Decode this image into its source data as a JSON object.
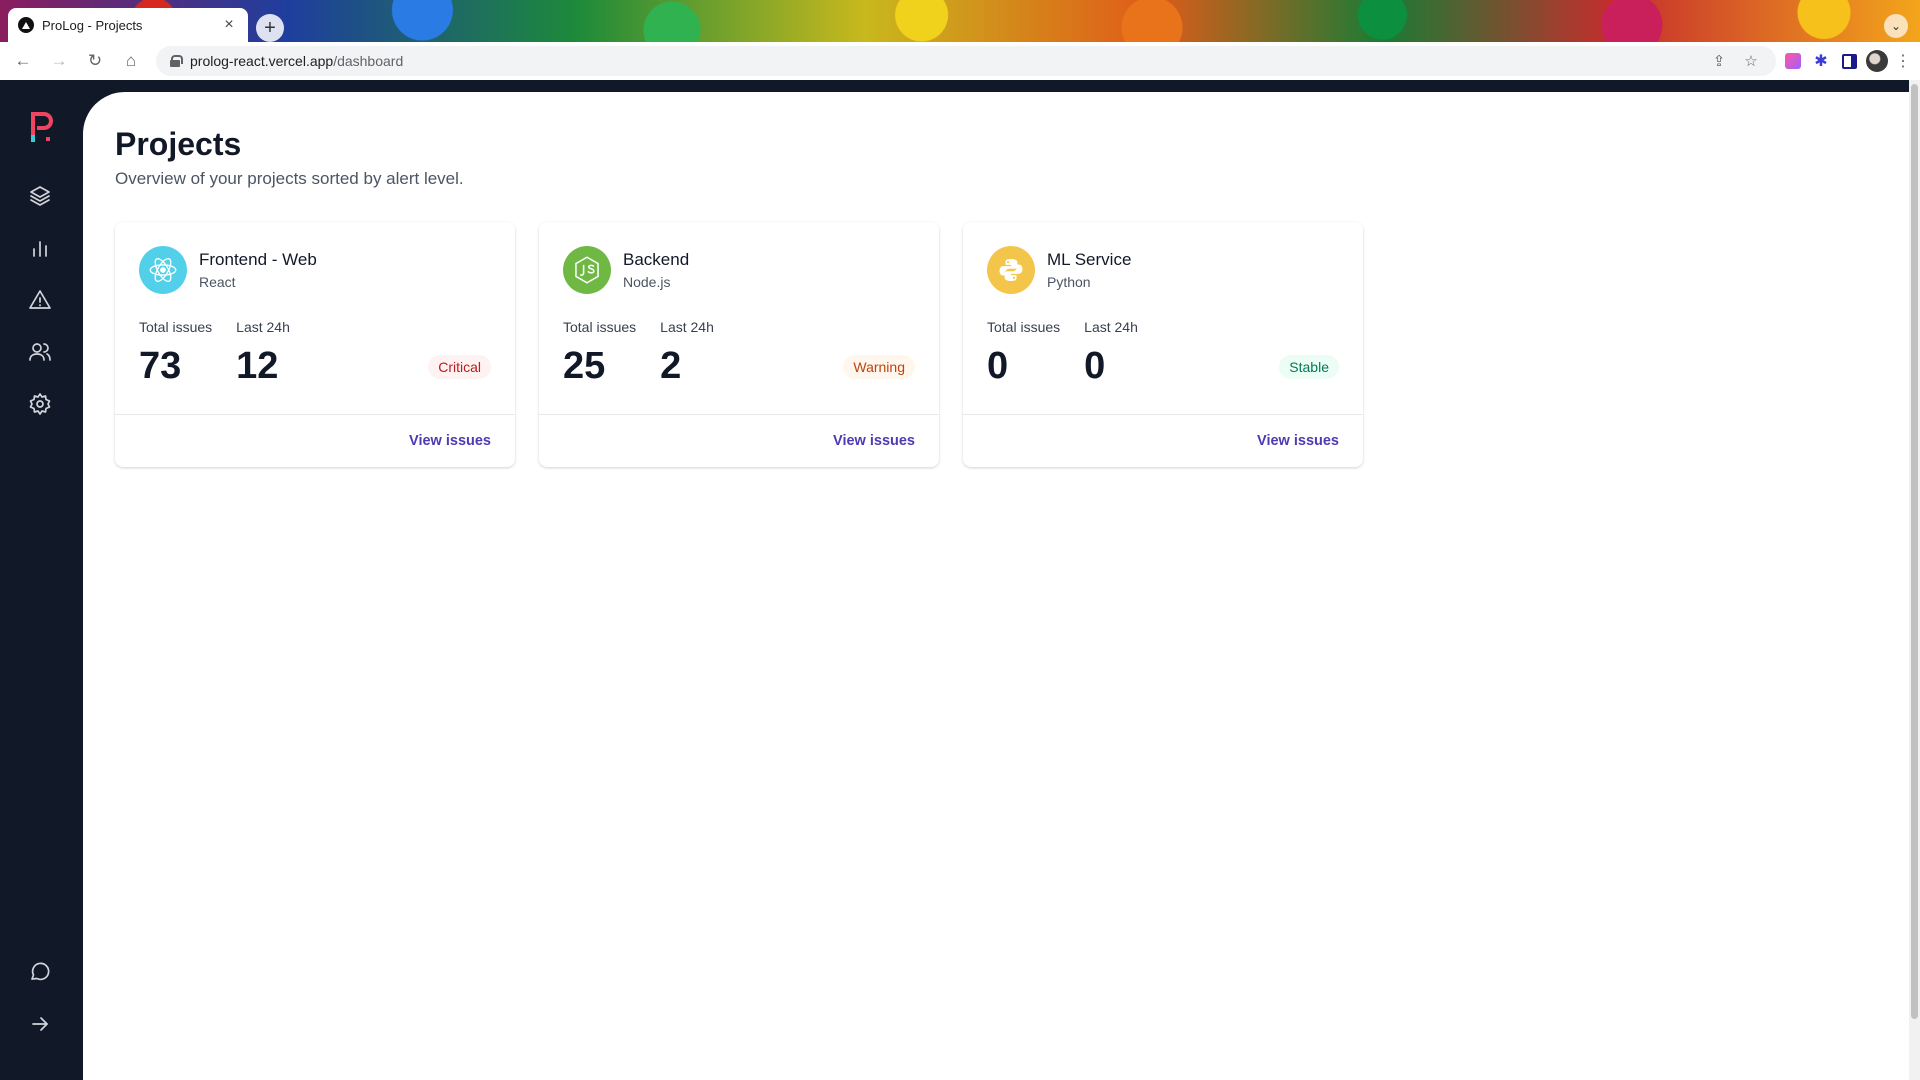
{
  "browser": {
    "tab_title": "ProLog - Projects",
    "tab_close": "×",
    "new_tab": "+",
    "url_host": "prolog-react.vercel.app",
    "url_path": "/dashboard"
  },
  "sidebar": {
    "items": [
      {
        "name": "projects",
        "icon": "layers-icon"
      },
      {
        "name": "stats",
        "icon": "bar-chart-icon"
      },
      {
        "name": "issues",
        "icon": "alert-triangle-icon"
      },
      {
        "name": "users",
        "icon": "users-icon"
      },
      {
        "name": "settings",
        "icon": "gear-icon"
      }
    ],
    "bottom_items": [
      {
        "name": "support",
        "icon": "chat-bubble-icon"
      },
      {
        "name": "collapse",
        "icon": "arrow-right-icon"
      }
    ],
    "logo_colors": {
      "primary": "#ef4561",
      "accent": "#3acbd8"
    }
  },
  "page": {
    "title": "Projects",
    "subtitle": "Overview of your projects sorted by alert level."
  },
  "projects": [
    {
      "name": "Frontend - Web",
      "language": "React",
      "icon": "react-icon",
      "icon_bg": "#52d0ea",
      "total_label": "Total issues",
      "total": "73",
      "last_label": "Last 24h",
      "last": "12",
      "status": "Critical",
      "link": "View issues"
    },
    {
      "name": "Backend",
      "language": "Node.js",
      "icon": "nodejs-icon",
      "icon_bg": "#6fb843",
      "total_label": "Total issues",
      "total": "25",
      "last_label": "Last 24h",
      "last": "2",
      "status": "Warning",
      "link": "View issues"
    },
    {
      "name": "ML Service",
      "language": "Python",
      "icon": "python-icon",
      "icon_bg": "#f3c54b",
      "total_label": "Total issues",
      "total": "0",
      "last_label": "Last 24h",
      "last": "0",
      "status": "Stable",
      "link": "View issues"
    }
  ],
  "colors": {
    "sidebar_bg": "#111827",
    "link": "#4c3bb3",
    "critical": "#b91c1c",
    "warning": "#c2410c",
    "stable": "#047857"
  }
}
